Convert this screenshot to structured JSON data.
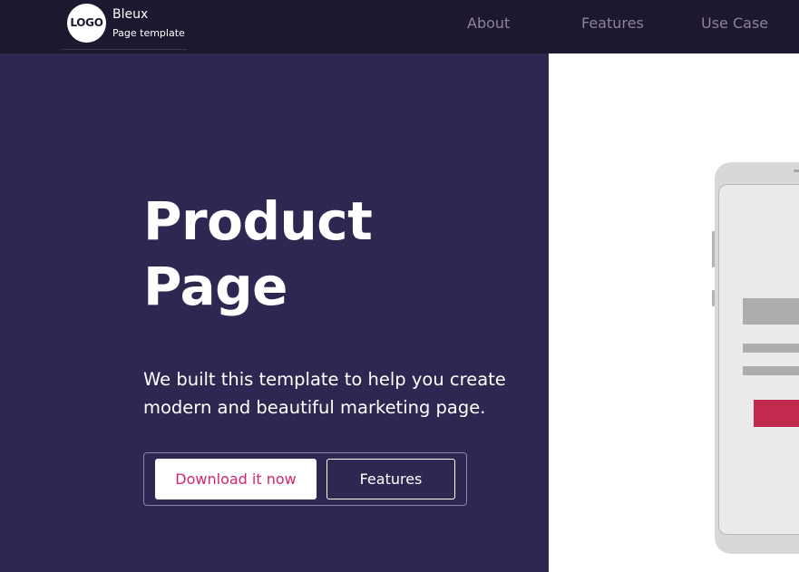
{
  "brand": {
    "logo_text": "LOGO",
    "name": "Bleux",
    "tagline": "Page template"
  },
  "nav": {
    "items": [
      {
        "label": "About"
      },
      {
        "label": "Features"
      },
      {
        "label": "Use Case"
      }
    ]
  },
  "hero": {
    "title_line1": "Product",
    "title_line2": "Page",
    "subtitle_line1": "We built this template to help you create",
    "subtitle_line2": "modern and beautiful marketing page.",
    "primary_cta": "Download it now",
    "secondary_cta": "Features"
  },
  "colors": {
    "nav_background": "#1e1730",
    "hero_background": "#2f2651",
    "primary_cta_text": "#d6246f",
    "mockup_button": "#c2294f"
  }
}
